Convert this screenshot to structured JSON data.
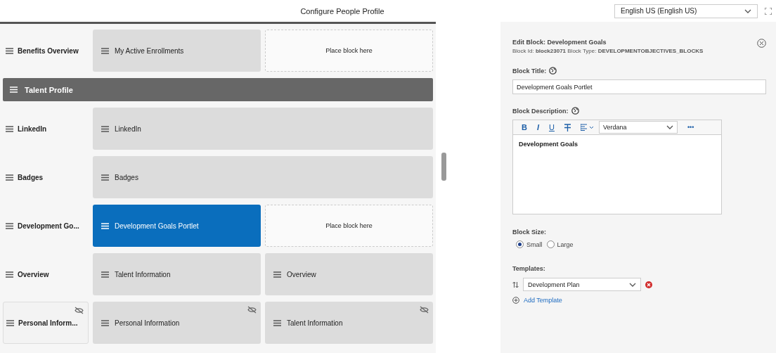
{
  "header": {
    "title": "Configure People Profile",
    "language": "English US (English US)"
  },
  "rows": [
    {
      "kind": "row",
      "label": "Benefits Overview",
      "hidden": false,
      "blocks": [
        {
          "kind": "block",
          "label": "My Active Enrollments",
          "selected": false,
          "hidden": false
        },
        {
          "kind": "placeholder",
          "label": "Place block here"
        }
      ]
    },
    {
      "kind": "section",
      "label": "Talent Profile"
    },
    {
      "kind": "row",
      "label": "LinkedIn",
      "hidden": false,
      "blocks": [
        {
          "kind": "block",
          "label": "LinkedIn",
          "selected": false,
          "hidden": false
        }
      ]
    },
    {
      "kind": "row",
      "label": "Badges",
      "hidden": false,
      "blocks": [
        {
          "kind": "block",
          "label": "Badges",
          "selected": false,
          "hidden": false
        }
      ]
    },
    {
      "kind": "row",
      "label": "Development Go...",
      "hidden": false,
      "blocks": [
        {
          "kind": "block",
          "label": "Development Goals Portlet",
          "selected": true,
          "hidden": false
        },
        {
          "kind": "placeholder",
          "label": "Place block here"
        }
      ]
    },
    {
      "kind": "row",
      "label": "Overview",
      "hidden": false,
      "blocks": [
        {
          "kind": "block",
          "label": "Talent Information",
          "selected": false,
          "hidden": false
        },
        {
          "kind": "block",
          "label": "Overview",
          "selected": false,
          "hidden": false
        }
      ]
    },
    {
      "kind": "row",
      "label": "Personal Inform...",
      "hidden": true,
      "blocks": [
        {
          "kind": "block",
          "label": "Personal Information",
          "selected": false,
          "hidden": true
        },
        {
          "kind": "block",
          "label": "Talent Information",
          "selected": false,
          "hidden": true
        }
      ]
    }
  ],
  "editor": {
    "title": "Edit Block: Development Goals",
    "meta": "Block Id: **block23071** Block Type: **DEVELOPMENTOBJECTIVES_BLOCKS**",
    "title_label": "Block Title:",
    "title_value": "Development Goals Portlet",
    "description_label": "Block Description:",
    "toolbar": [
      {
        "kind": "bold",
        "label": "B"
      },
      {
        "kind": "italic",
        "label": "I"
      },
      {
        "kind": "underline",
        "label": "U"
      },
      {
        "kind": "strike"
      },
      {
        "kind": "align"
      }
    ],
    "font": "Verdana",
    "more": "•••",
    "description_value": "Development Goals",
    "size_label": "Block Size:",
    "sizes": [
      {
        "label": "Small",
        "selected": true
      },
      {
        "label": "Large",
        "selected": false
      }
    ],
    "templates_label": "Templates:",
    "template": "Development Plan",
    "add_template": "Add Template"
  }
}
